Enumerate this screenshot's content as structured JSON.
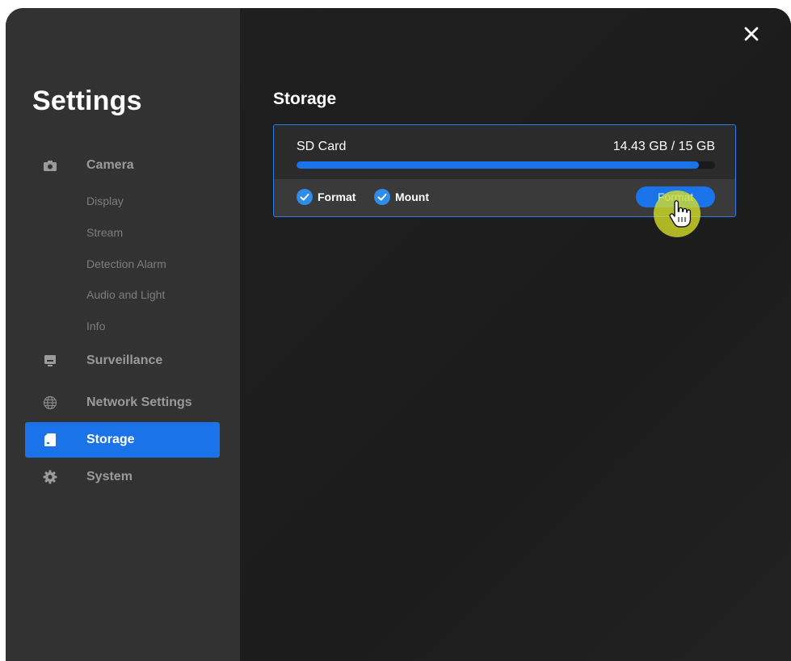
{
  "sidebar": {
    "title": "Settings",
    "items": [
      {
        "label": "Camera",
        "icon": "camera-icon"
      },
      {
        "label": "Surveillance",
        "icon": "monitor-icon"
      },
      {
        "label": "Network Settings",
        "icon": "globe-icon"
      },
      {
        "label": "Storage",
        "icon": "sd-card-icon",
        "active": true
      },
      {
        "label": "System",
        "icon": "gear-icon"
      }
    ],
    "camera_subitems": [
      "Display",
      "Stream",
      "Detection Alarm",
      "Audio and Light",
      "Info"
    ]
  },
  "main": {
    "section_title": "Storage",
    "card": {
      "name": "SD Card",
      "size": "14.43 GB / 15 GB",
      "used_fraction": 0.962,
      "checks": [
        {
          "label": "Format",
          "checked": true
        },
        {
          "label": "Mount",
          "checked": true
        }
      ],
      "button_label": "Format"
    }
  },
  "colors": {
    "accent": "#1a73e8",
    "sidebar_bg": "#323232",
    "main_bg": "#1e1e1e",
    "cursor_highlight": "#d7e128"
  }
}
